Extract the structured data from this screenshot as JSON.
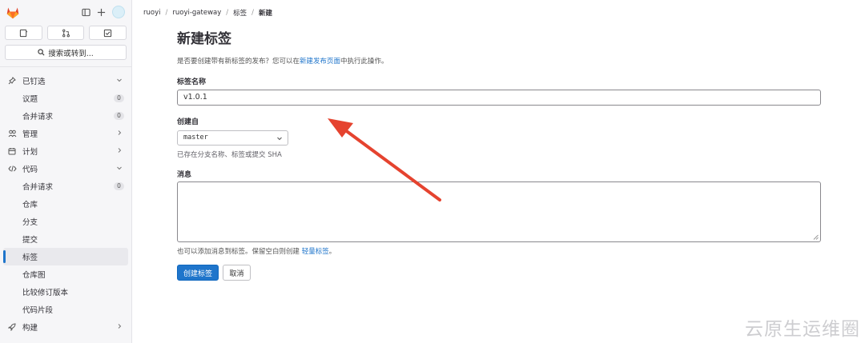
{
  "sidebar": {
    "search_label": "搜索或转到...",
    "nav": {
      "pinned": "已钉选",
      "issues": "议题",
      "issues_count": "0",
      "merge_requests": "合并请求",
      "merge_requests_count": "0",
      "manage": "管理",
      "plan": "计划",
      "code": "代码",
      "code_mr": "合并请求",
      "code_mr_count": "0",
      "repository": "仓库",
      "branches": "分支",
      "commits": "提交",
      "tags": "标签",
      "graph": "仓库图",
      "compare": "比较修订版本",
      "snippets": "代码片段",
      "build": "构建"
    }
  },
  "breadcrumb": [
    "ruoyi",
    "ruoyi-gateway",
    "标签",
    "新建"
  ],
  "form": {
    "title": "新建标签",
    "desc_prefix": "是否要创建带有新标签的发布？您可以在",
    "desc_link": "新建发布页面",
    "desc_suffix": "中执行此操作。",
    "tag_name_label": "标签名称",
    "tag_name_value": "v1.0.1",
    "create_from_label": "创建自",
    "create_from_value": "master",
    "create_from_hint": "已存在分支名称、标签或提交 SHA",
    "message_label": "消息",
    "message_hint_prefix": "也可以添加消息到标签。保留空白则创建 ",
    "message_hint_link": "轻量标签",
    "message_hint_suffix": "。",
    "submit_label": "创建标签",
    "cancel_label": "取消"
  },
  "watermark": "云原生运维圈",
  "colors": {
    "accent": "#1f75cb",
    "annotation_arrow": "#e5432f"
  }
}
